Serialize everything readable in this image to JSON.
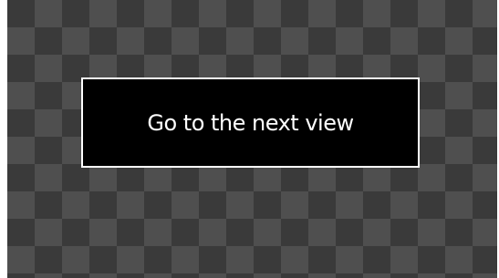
{
  "button": {
    "label": "Go to the next view"
  },
  "colors": {
    "button_background": "#000000",
    "button_border": "#ffffff",
    "button_text": "#ffffff",
    "checker_dark": "#3a3a3a",
    "checker_light": "#4f4f4f"
  }
}
